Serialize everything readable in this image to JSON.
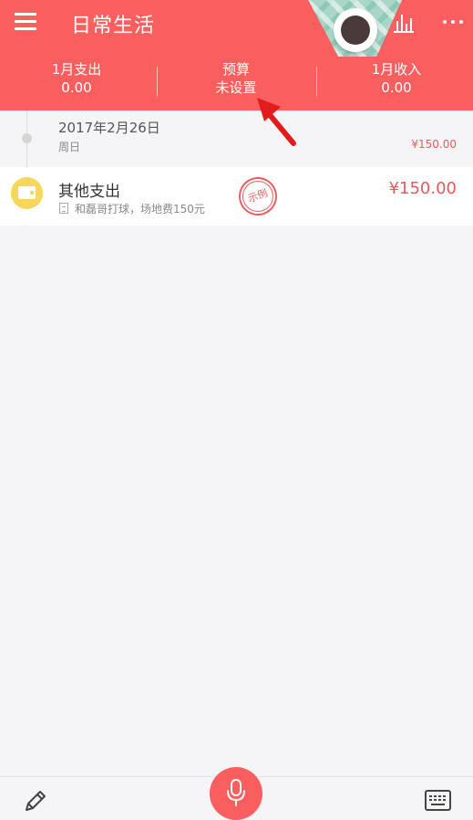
{
  "header": {
    "title": "日常生活",
    "stats": {
      "expense": {
        "label": "1月支出",
        "value": "0.00"
      },
      "budget": {
        "label": "预算",
        "value": "未设置"
      },
      "income": {
        "label": "1月收入",
        "value": "0.00"
      }
    },
    "icons": [
      "menu-icon",
      "coffee-cup-avatar",
      "bar-chart-icon",
      "more-icon"
    ]
  },
  "timeline": {
    "date": "2017年2月26日",
    "weekday": "周日",
    "day_total": "¥150.00",
    "entries": [
      {
        "category": "其他支出",
        "note": "和磊哥打球，场地费150元",
        "stamp": "示例",
        "amount": "¥150.00",
        "icon": "wallet-icon"
      }
    ]
  },
  "bottom_bar": {
    "icons": [
      "pencil-icon",
      "microphone-icon",
      "keyboard-icon"
    ]
  },
  "colors": {
    "brand": "#fa5f5f",
    "amount": "#e85a5a",
    "category_icon": "#f7d65c",
    "background": "#f5f4f6"
  }
}
